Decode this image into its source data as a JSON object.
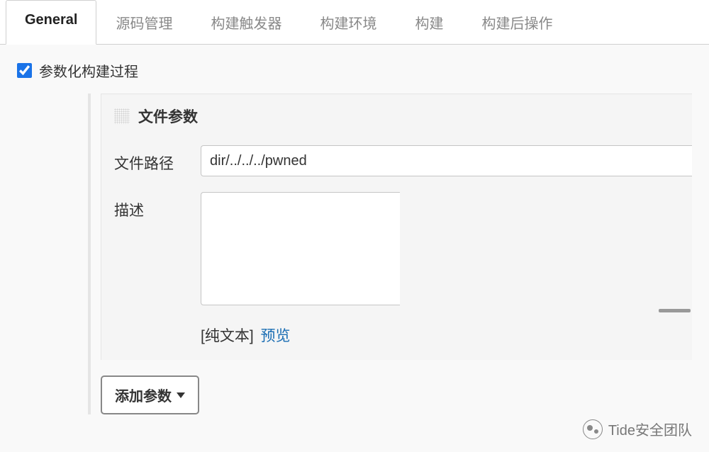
{
  "tabs": [
    {
      "label": "General",
      "active": true
    },
    {
      "label": "源码管理",
      "active": false
    },
    {
      "label": "构建触发器",
      "active": false
    },
    {
      "label": "构建环境",
      "active": false
    },
    {
      "label": "构建",
      "active": false
    },
    {
      "label": "构建后操作",
      "active": false
    }
  ],
  "checkbox": {
    "label": "参数化构建过程",
    "checked": true
  },
  "param": {
    "title": "文件参数",
    "filePathLabel": "文件路径",
    "filePathValue": "dir/../../../pwned",
    "descLabel": "描述",
    "descValue": "",
    "plainText": "[纯文本]",
    "previewLink": "预览"
  },
  "addParamBtn": "添加参数",
  "watermark": "Tide安全团队"
}
